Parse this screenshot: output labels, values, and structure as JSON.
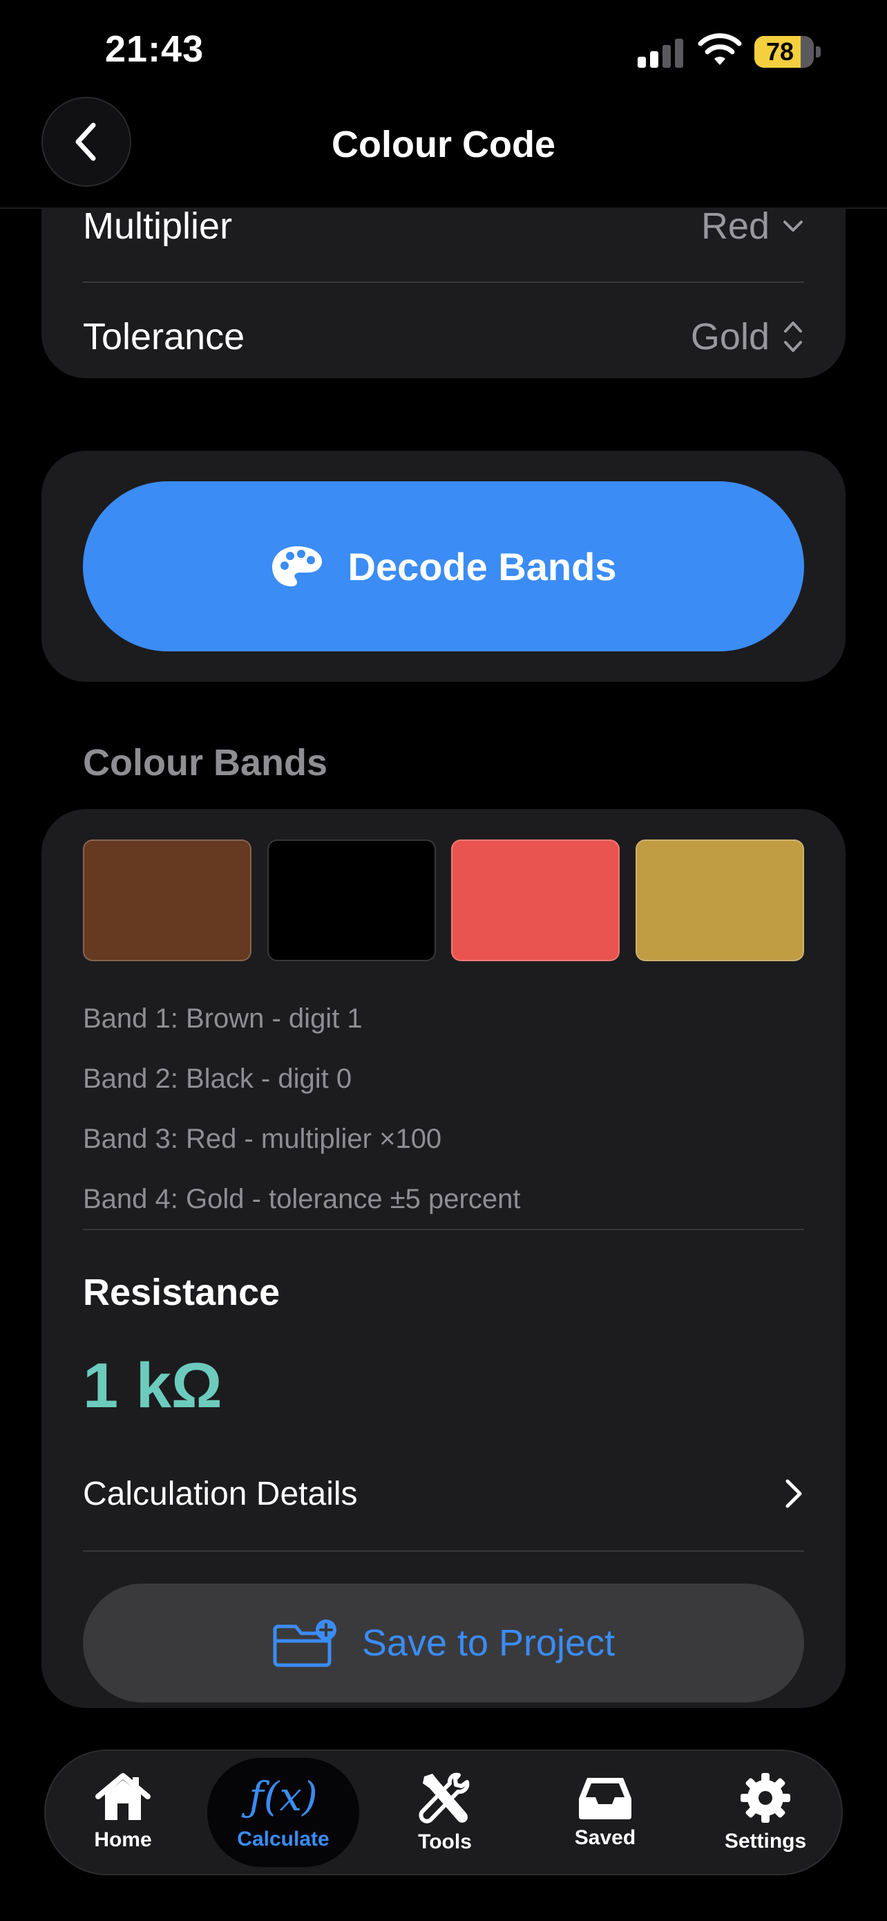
{
  "status_bar": {
    "time": "21:43",
    "battery_level": "78",
    "battery_fraction": 0.78,
    "battery_color": "#f4cf3e"
  },
  "nav": {
    "title": "Colour Code",
    "back_icon": "chevron-left-icon"
  },
  "pickers": [
    {
      "label": "Multiplier",
      "value": "Red",
      "icon": "chevron-down-icon"
    },
    {
      "label": "Tolerance",
      "value": "Gold",
      "icon": "chevron-up-down-icon"
    }
  ],
  "decode": {
    "label": "Decode Bands",
    "icon": "palette-icon",
    "color": "#3b8cf5"
  },
  "colour_bands": {
    "heading": "Colour Bands",
    "swatches": [
      {
        "name": "Brown",
        "color": "#653a21"
      },
      {
        "name": "Black",
        "color": "#000000"
      },
      {
        "name": "Red",
        "color": "#ea5450"
      },
      {
        "name": "Gold",
        "color": "#c09d43"
      }
    ],
    "descriptions": [
      "Band 1: Brown - digit 1",
      "Band 2: Black - digit 0",
      "Band 3: Red - multiplier ×100",
      "Band 4: Gold - tolerance ±5 percent"
    ]
  },
  "result": {
    "label": "Resistance",
    "value": "1 kΩ",
    "value_color": "#6ccbbd",
    "details_label": "Calculation Details",
    "details_icon": "chevron-right-icon"
  },
  "save": {
    "label": "Save to Project",
    "icon": "folder-plus-icon"
  },
  "tabs": [
    {
      "label": "Home",
      "icon": "house-icon",
      "active": false
    },
    {
      "label": "Calculate",
      "icon": "function-icon",
      "glyph": "ƒ(x)",
      "active": true
    },
    {
      "label": "Tools",
      "icon": "wrench-screwdriver-icon",
      "active": false
    },
    {
      "label": "Saved",
      "icon": "tray-icon",
      "active": false
    },
    {
      "label": "Settings",
      "icon": "gear-icon",
      "active": false
    }
  ]
}
